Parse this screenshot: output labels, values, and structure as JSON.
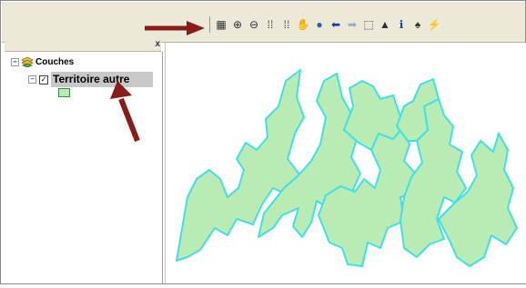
{
  "toolbar": {
    "buttons": [
      {
        "name": "full-extent-icon",
        "glyph": "▦"
      },
      {
        "name": "zoom-in-icon",
        "glyph": "⊕"
      },
      {
        "name": "zoom-out-icon",
        "glyph": "⊖"
      },
      {
        "name": "fixed-zoom-in-icon",
        "glyph": "⁞⁞"
      },
      {
        "name": "fixed-zoom-out-icon",
        "glyph": "⁞⁞"
      },
      {
        "name": "pan-icon",
        "glyph": "✋"
      },
      {
        "name": "globe-icon",
        "glyph": "●"
      },
      {
        "name": "back-icon",
        "glyph": "⬅"
      },
      {
        "name": "forward-icon",
        "glyph": "➡"
      },
      {
        "name": "select-features-icon",
        "glyph": "⬚"
      },
      {
        "name": "select-elements-icon",
        "glyph": "▲"
      },
      {
        "name": "identify-icon",
        "glyph": "ℹ"
      },
      {
        "name": "find-icon",
        "glyph": "♠"
      },
      {
        "name": "hyperlink-icon",
        "glyph": "⚡"
      }
    ]
  },
  "toc": {
    "close_glyph": "x",
    "root_label": "Couches",
    "root_expander": "−",
    "layer": {
      "expander": "−",
      "checked_glyph": "✓",
      "label": "Territoire autre",
      "fill_color": "#b8ecb4"
    }
  },
  "map": {
    "fill_color": "#b8ecb4",
    "outline_color": "#3fe0e6"
  },
  "annotations": {
    "arrow_color": "#8b1a1a"
  }
}
